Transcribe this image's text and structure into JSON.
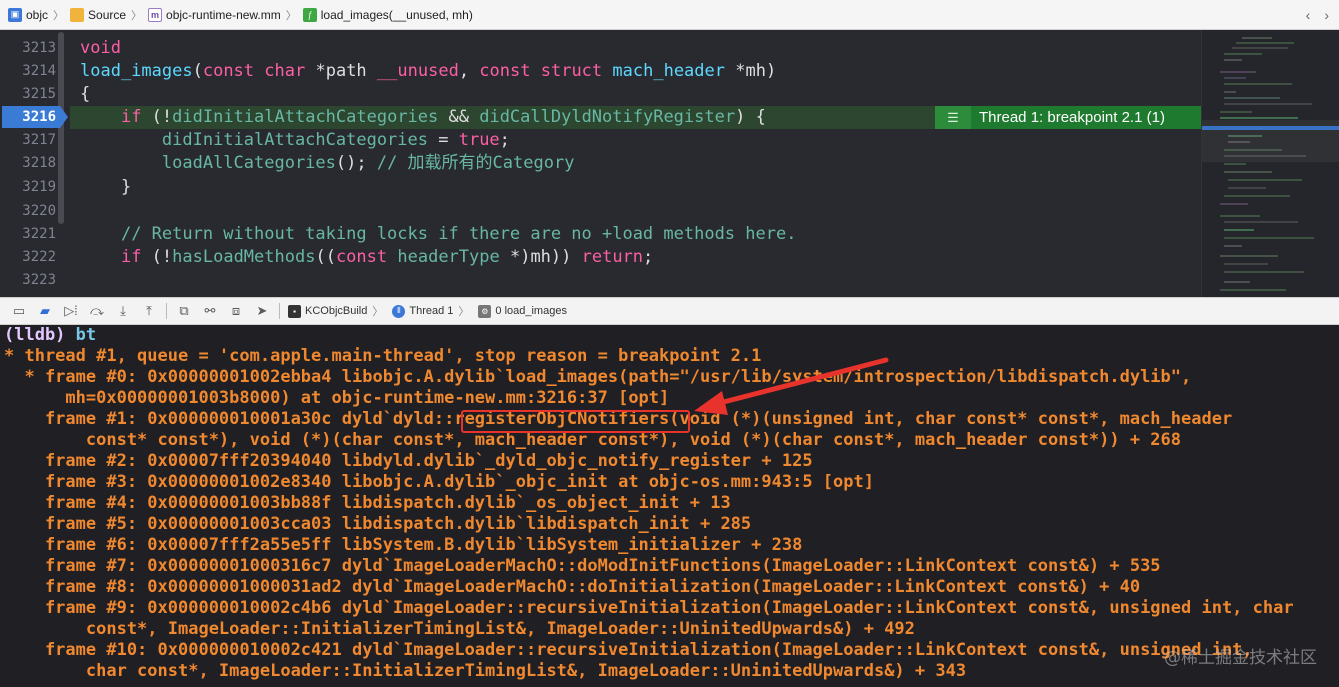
{
  "jumpbar": {
    "crumbs": [
      {
        "label": "objc",
        "icon": "project-icon"
      },
      {
        "label": "Source",
        "icon": "folder-icon"
      },
      {
        "label": "objc-runtime-new.mm",
        "icon": "objc-file-icon"
      },
      {
        "label": "load_images(__unused, mh)",
        "icon": "function-icon"
      }
    ]
  },
  "editor": {
    "line_numbers": [
      "3213",
      "3214",
      "3215",
      "3216",
      "3217",
      "3218",
      "3219",
      "3220",
      "3221",
      "3222",
      "3223"
    ],
    "current_line": "3216",
    "code": {
      "l3213": "void",
      "l3214_a": "load_images",
      "l3214_b": "(",
      "l3214_c": "const",
      "l3214_d": "char",
      "l3214_e": "*path",
      "l3214_f": "__unused",
      "l3214_g": ", ",
      "l3214_h": "const",
      "l3214_i": "struct",
      "l3214_j": "mach_header",
      "l3214_k": "*mh)",
      "l3215": "{",
      "l3216_a": "if",
      "l3216_b": " (!",
      "l3216_c": "didInitialAttachCategories",
      "l3216_d": " && ",
      "l3216_e": "didCallDyldNotifyRegister",
      "l3216_f": ") {",
      "l3217_a": "didInitialAttachCategories",
      "l3217_b": " = ",
      "l3217_c": "true",
      "l3217_d": ";",
      "l3218_a": "loadAllCategories",
      "l3218_b": "(); ",
      "l3218_c": "// 加载所有的Category",
      "l3219": "}",
      "l3221": "// Return without taking locks if there are no +load methods here.",
      "l3222_a": "if",
      "l3222_b": " (!",
      "l3222_c": "hasLoadMethods",
      "l3222_d": "((",
      "l3222_e": "const",
      "l3222_f": " ",
      "l3222_g": "headerType",
      "l3222_h": " *)mh)) ",
      "l3222_i": "return",
      "l3222_j": ";"
    },
    "annotation": "Thread 1: breakpoint 2.1 (1)"
  },
  "debugbar": {
    "crumbs": [
      {
        "label": "KCObjcBuild",
        "icon": "target-icon"
      },
      {
        "label": "Thread 1",
        "icon": "thread-icon"
      },
      {
        "label": "0 load_images",
        "icon": "frame-icon"
      }
    ]
  },
  "console": {
    "prompt": "(lldb)",
    "command": "bt",
    "lines": [
      "* thread #1, queue = 'com.apple.main-thread', stop reason = breakpoint 2.1",
      "  * frame #0: 0x00000001002ebba4 libobjc.A.dylib`load_images(path=\"/usr/lib/system/introspection/libdispatch.dylib\",",
      "      mh=0x00000001003b8000) at objc-runtime-new.mm:3216:37 [opt]",
      "    frame #1: 0x000000010001a30c dyld`dyld::registerObjCNotifiers(void (*)(unsigned int, char const* const*, mach_header",
      "        const* const*), void (*)(char const*, mach_header const*), void (*)(char const*, mach_header const*)) + 268",
      "    frame #2: 0x00007fff20394040 libdyld.dylib`_dyld_objc_notify_register + 125",
      "    frame #3: 0x00000001002e8340 libobjc.A.dylib`_objc_init at objc-os.mm:943:5 [opt]",
      "    frame #4: 0x00000001003bb88f libdispatch.dylib`_os_object_init + 13",
      "    frame #5: 0x00000001003cca03 libdispatch.dylib`libdispatch_init + 285",
      "    frame #6: 0x00007fff2a55e5ff libSystem.B.dylib`libSystem_initializer + 238",
      "    frame #7: 0x00000001000316c7 dyld`ImageLoaderMachO::doModInitFunctions(ImageLoader::LinkContext const&) + 535",
      "    frame #8: 0x00000001000031ad2 dyld`ImageLoaderMachO::doInitialization(ImageLoader::LinkContext const&) + 40",
      "    frame #9: 0x000000010002c4b6 dyld`ImageLoader::recursiveInitialization(ImageLoader::LinkContext const&, unsigned int, char",
      "        const*, ImageLoader::InitializerTimingList&, ImageLoader::UninitedUpwards&) + 492",
      "    frame #10: 0x000000010002c421 dyld`ImageLoader::recursiveInitialization(ImageLoader::LinkContext const&, unsigned int,",
      "        char const*, ImageLoader::InitializerTimingList&, ImageLoader::UninitedUpwards&) + 343"
    ],
    "highlighted_symbol": "registerObjCNotifiers",
    "watermark": "@稀土掘金技术社区"
  },
  "colors": {
    "console_text": "#f0882f",
    "highlight_box": "#e8322c",
    "breakpoint": "#3a7bd5",
    "thread_annotation": "#1e7a2e"
  }
}
